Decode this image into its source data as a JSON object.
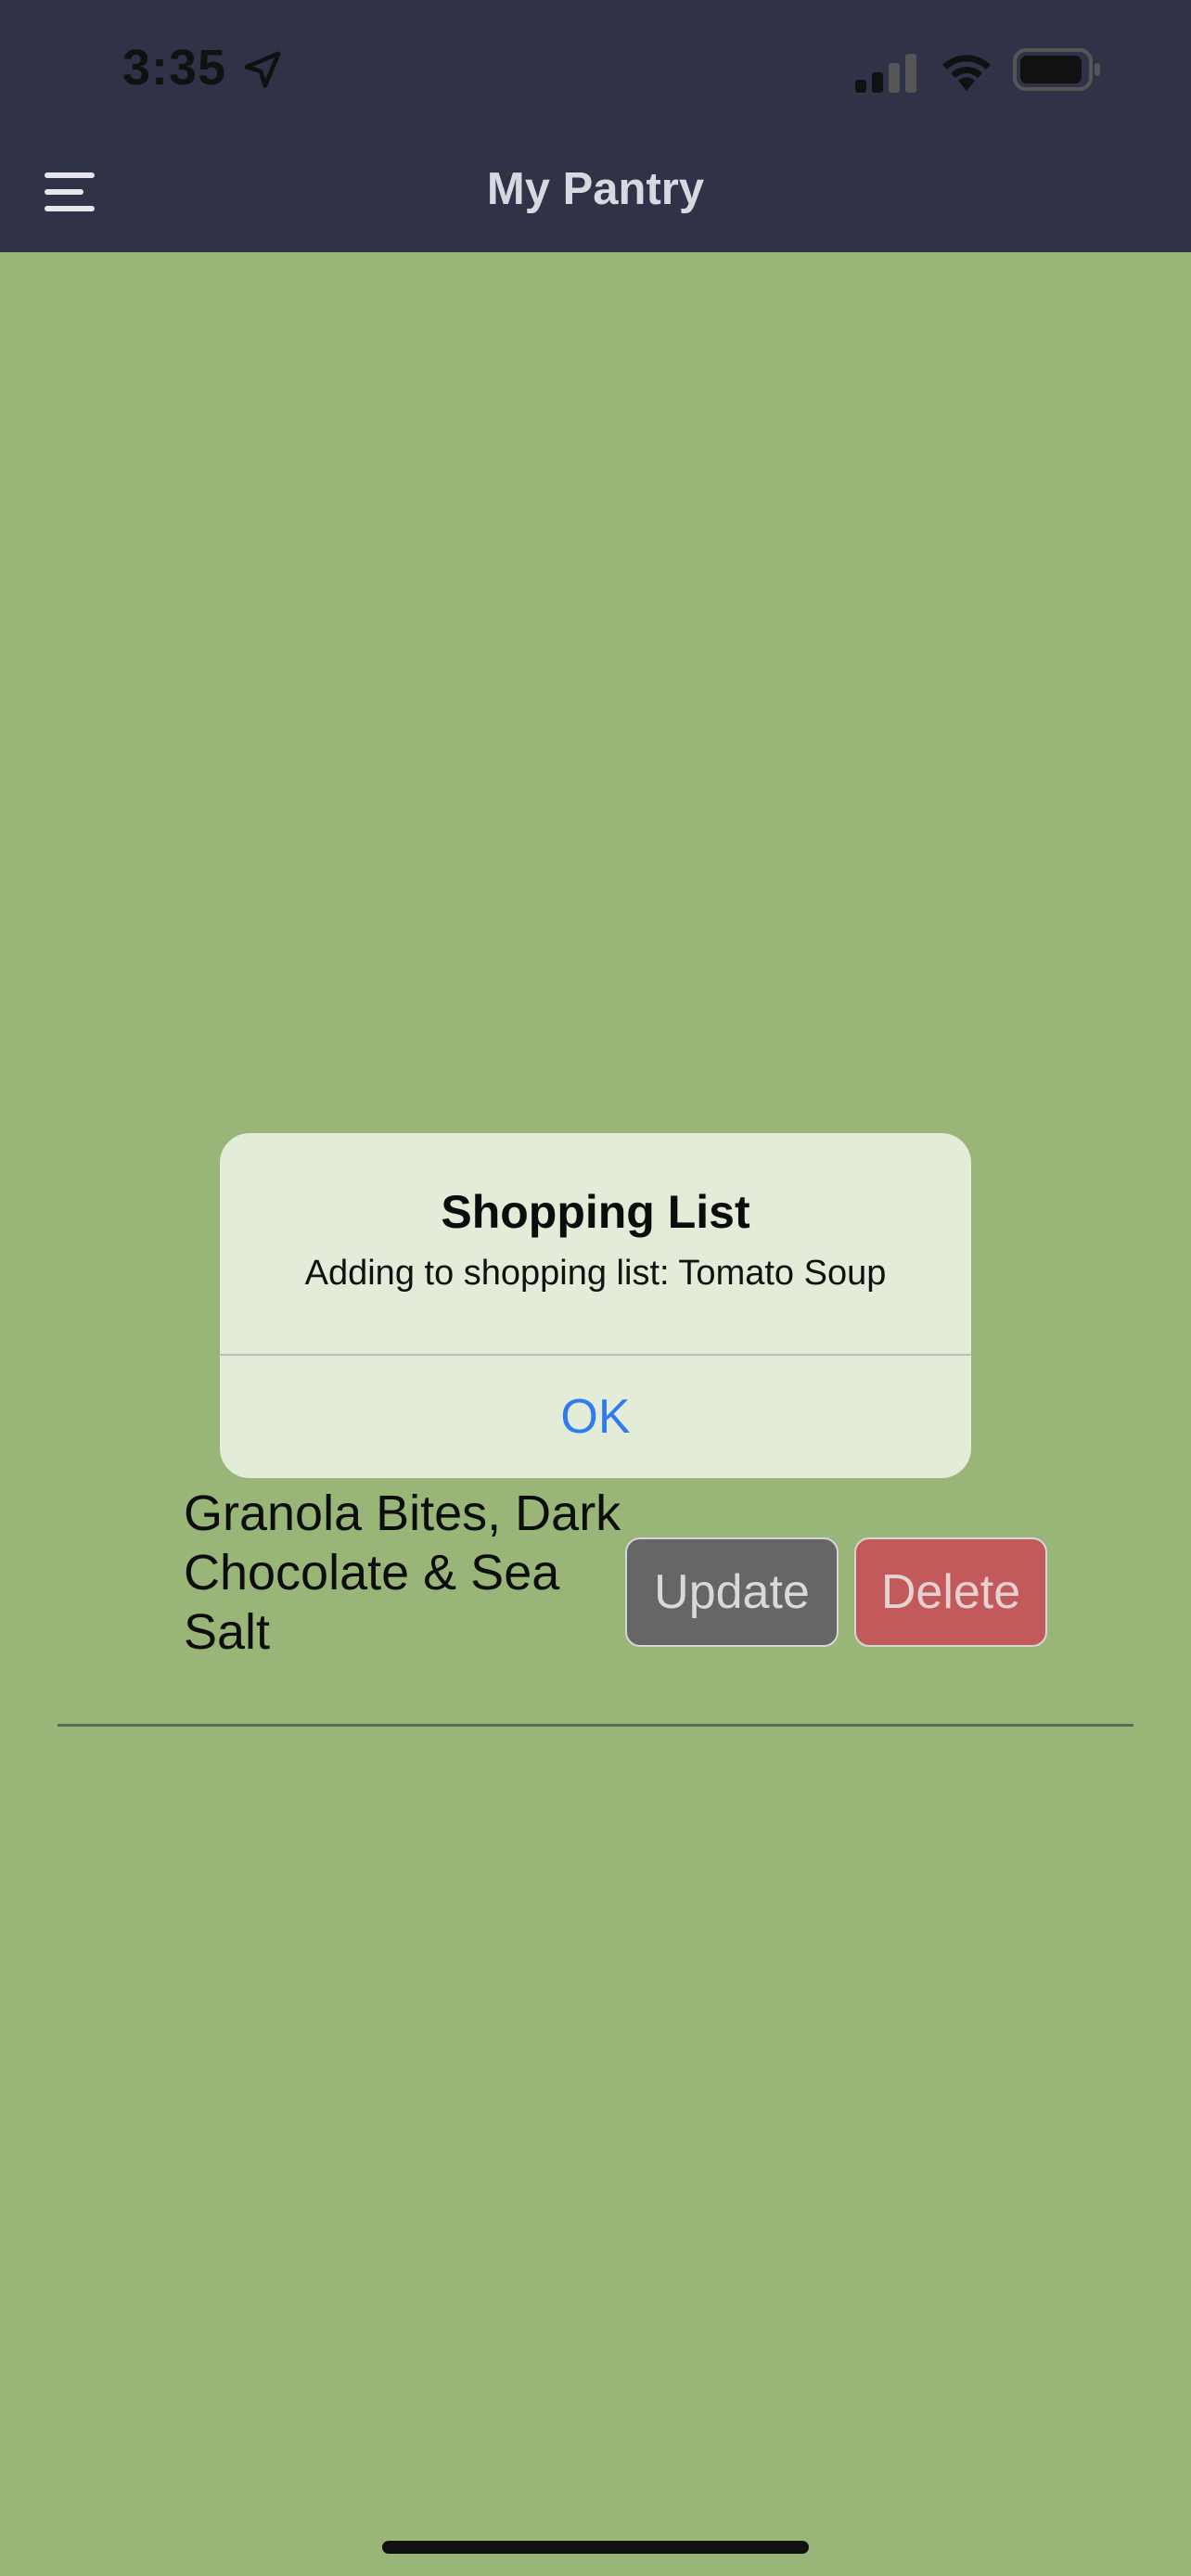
{
  "status_bar": {
    "time": "3:35",
    "icons": [
      "location-arrow-icon",
      "signal-icon",
      "wifi-icon",
      "battery-icon"
    ]
  },
  "header": {
    "title": "My Pantry",
    "menu_icon": "hamburger-menu-icon"
  },
  "pantry_item": {
    "name": "Granola Bites, Dark Chocolate & Sea Salt",
    "update_label": "Update",
    "delete_label": "Delete"
  },
  "alert": {
    "title": "Shopping List",
    "message": "Adding to shopping list: Tomato Soup",
    "ok_label": "OK"
  },
  "colors": {
    "header_bg": "#303347",
    "page_bg": "#99b577",
    "update_button": "#666666",
    "delete_button": "#c25a5c",
    "alert_bg": "#e3ecd8",
    "alert_action": "#2f7cf0"
  }
}
